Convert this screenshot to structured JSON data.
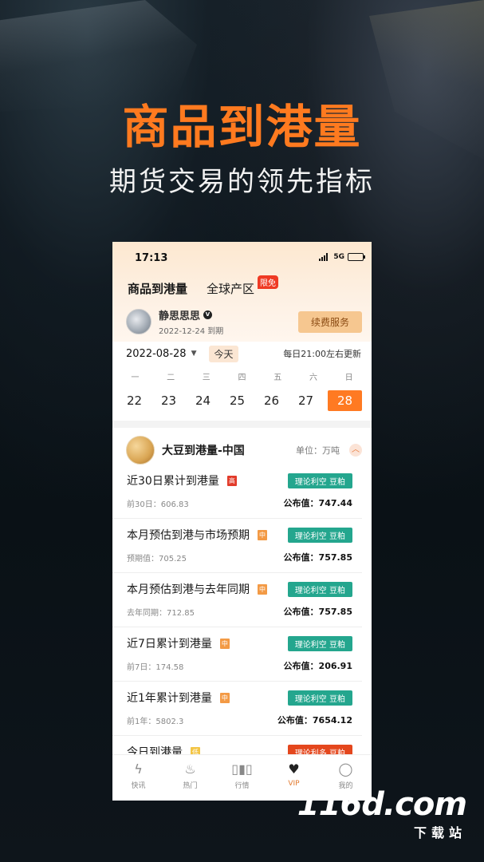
{
  "promo": {
    "headline": "商品到港量",
    "subline": "期货交易的领先指标"
  },
  "watermark": {
    "main": "116d.com",
    "sub": "下载站"
  },
  "status_bar": {
    "time": "17:13",
    "network": "5G"
  },
  "header": {
    "tab_active": "商品到港量",
    "tab_other": "全球产区",
    "badge": "限免"
  },
  "user": {
    "name": "静思思思",
    "vip_mark": "V",
    "expire": "2022-12-24 到期",
    "renew_label": "续费服务"
  },
  "date_bar": {
    "date": "2022-08-28",
    "caret": "▼",
    "today_label": "今天",
    "update_note": "每日21:00左右更新"
  },
  "week": {
    "labels": [
      "一",
      "二",
      "三",
      "四",
      "五",
      "六",
      "日"
    ],
    "days": [
      "22",
      "23",
      "24",
      "25",
      "26",
      "27",
      "28"
    ],
    "selected_index": 6
  },
  "section": {
    "title": "大豆到港量-中国",
    "unit": "单位：万吨",
    "collapse_icon": "chevron-up-icon"
  },
  "items": [
    {
      "name": "近30日累计到港量",
      "level": "高",
      "level_type": "high",
      "impact": "理论利空 豆粕",
      "prev": "前30日：606.83",
      "published": "公布值：747.44"
    },
    {
      "name": "本月预估到港与市场预期",
      "level": "中",
      "level_type": "mid",
      "impact": "理论利空 豆粕",
      "prev": "预期值：705.25",
      "published": "公布值：757.85"
    },
    {
      "name": "本月预估到港与去年同期",
      "level": "中",
      "level_type": "mid",
      "impact": "理论利空 豆粕",
      "prev": "去年同期：712.85",
      "published": "公布值：757.85"
    },
    {
      "name": "近7日累计到港量",
      "level": "中",
      "level_type": "mid",
      "impact": "理论利空 豆粕",
      "prev": "前7日：174.58",
      "published": "公布值：206.91"
    },
    {
      "name": "近1年累计到港量",
      "level": "中",
      "level_type": "mid",
      "impact": "理论利空 豆粕",
      "prev": "前1年：5802.3",
      "published": "公布值：7654.12"
    },
    {
      "name": "今日到港量",
      "level": "低",
      "level_type": "low",
      "impact": "理论利多 豆粕",
      "prev": "",
      "published": ""
    }
  ],
  "tabbar": [
    {
      "label": "快讯",
      "icon": "lightning-icon"
    },
    {
      "label": "热门",
      "icon": "flame-icon"
    },
    {
      "label": "行情",
      "icon": "candlestick-icon"
    },
    {
      "label": "VIP",
      "icon": "vip-icon"
    },
    {
      "label": "我的",
      "icon": "person-icon"
    }
  ],
  "tabbar_active_index": 3
}
